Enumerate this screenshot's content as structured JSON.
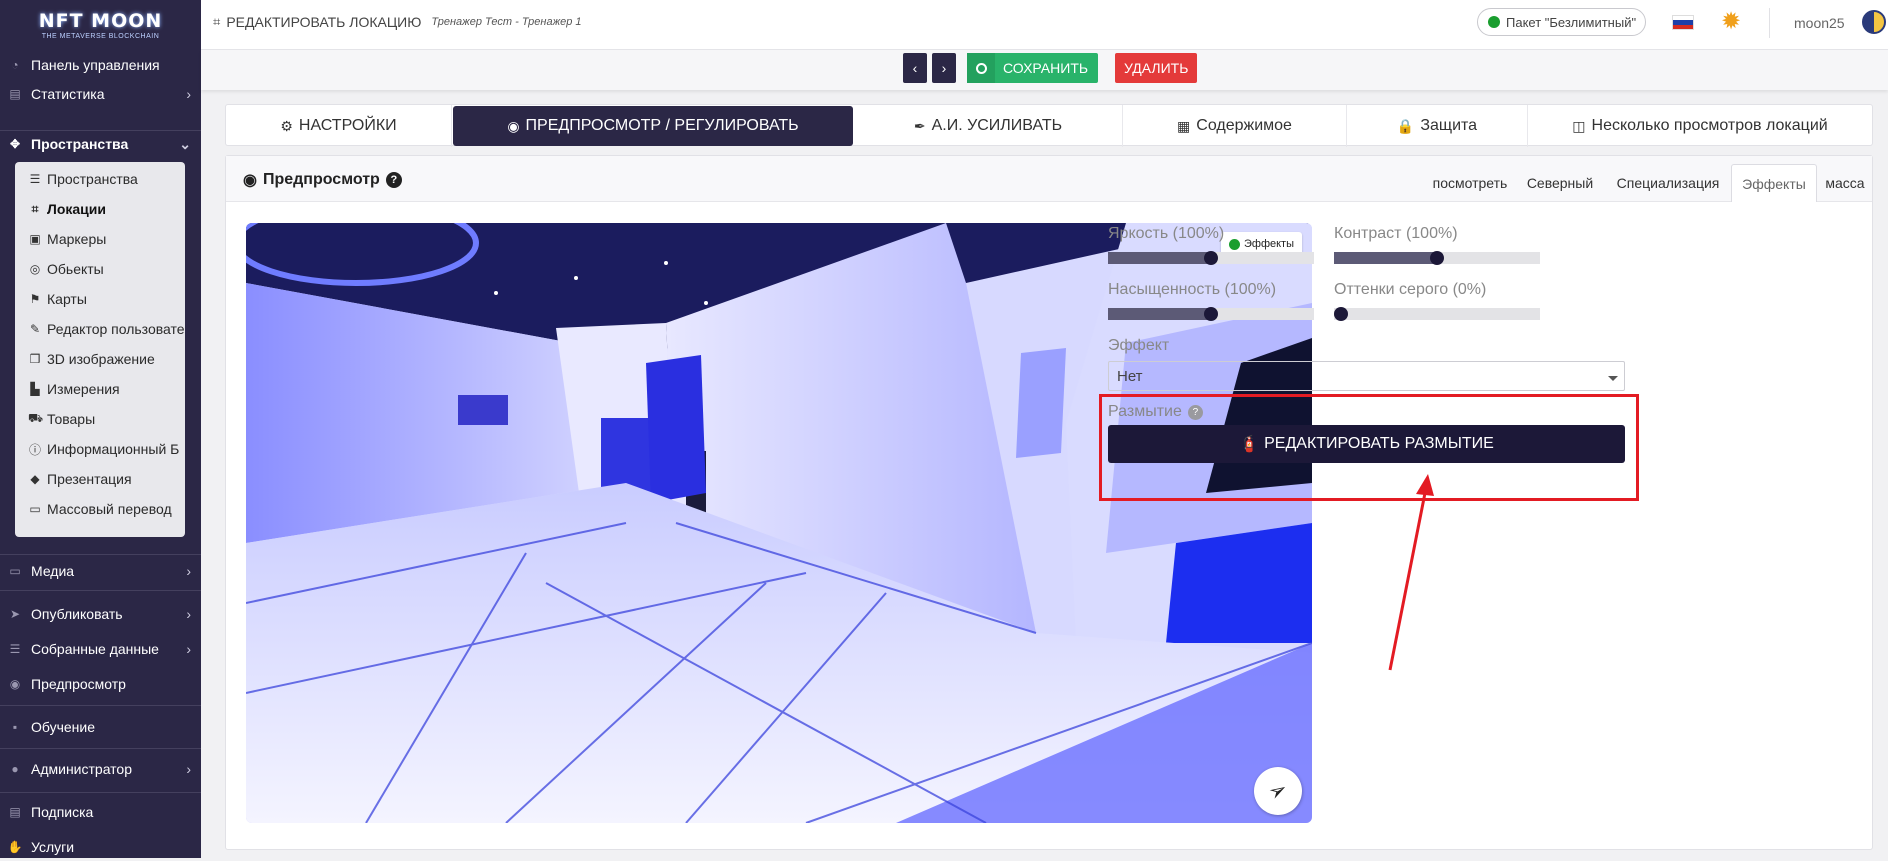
{
  "sidebar": {
    "logo": {
      "main": "NFT MOON",
      "tagline": "THE METAVERSE BLOCKCHAIN"
    },
    "items": [
      {
        "label": "Панель управления",
        "icon": "dashboard-icon"
      },
      {
        "label": "Статистика",
        "icon": "chart-icon"
      },
      {
        "label": "Пространства",
        "icon": "spaces-icon"
      },
      {
        "label": "Медиа",
        "icon": "monitor-icon"
      },
      {
        "label": "Опубликовать",
        "icon": "send-icon"
      },
      {
        "label": "Собранные данные",
        "icon": "database-icon"
      },
      {
        "label": "Предпросмотр",
        "icon": "eye-icon"
      },
      {
        "label": "Обучение",
        "icon": "briefcase-icon"
      },
      {
        "label": "Администратор",
        "icon": "user-icon"
      },
      {
        "label": "Подписка",
        "icon": "list-icon"
      },
      {
        "label": "Услуги",
        "icon": "hand-icon"
      }
    ],
    "subitems": [
      {
        "label": "Пространства",
        "icon": "list-icon"
      },
      {
        "label": "Локации",
        "icon": "location-icon"
      },
      {
        "label": "Маркеры",
        "icon": "image-icon"
      },
      {
        "label": "Обьекты",
        "icon": "target-icon"
      },
      {
        "label": "Карты",
        "icon": "map-icon"
      },
      {
        "label": "Редактор пользовате",
        "icon": "edit-icon"
      },
      {
        "label": "3D изображение",
        "icon": "cube-icon"
      },
      {
        "label": "Измерения",
        "icon": "ruler-icon"
      },
      {
        "label": "Товары",
        "icon": "cart-icon"
      },
      {
        "label": "Информационный Б",
        "icon": "info-icon"
      },
      {
        "label": "Презентация",
        "icon": "diamond-icon"
      },
      {
        "label": "Массовый перевод",
        "icon": "translate-icon"
      }
    ]
  },
  "header": {
    "title": "РЕДАКТИРОВАТЬ ЛОКАЦИЮ",
    "breadcrumb": "Тренажер Тест - Тренажер 1",
    "plan": "Пакет \"Безлимитный\"",
    "username": "moon25"
  },
  "toolbar": {
    "save_label": "СОХРАНИТЬ",
    "delete_label": "УДАЛИТЬ",
    "prev_label": "‹",
    "next_label": "›"
  },
  "tabs": [
    {
      "label": "НАСТРОЙКИ",
      "icon": "gears-icon"
    },
    {
      "label": "ПРЕДПРОСМОТР / РЕГУЛИРОВАТЬ",
      "icon": "eye-icon"
    },
    {
      "label": "А.И. УСИЛИВАТЬ",
      "icon": "brush-icon"
    },
    {
      "label": "Содержимое",
      "icon": "images-icon"
    },
    {
      "label": "Защита",
      "icon": "lock-icon"
    },
    {
      "label": "Несколько просмотров локаций",
      "icon": "columns-icon"
    }
  ],
  "preview": {
    "title": "Предпросмотр",
    "subtabs": [
      "посмотреть",
      "Северный",
      "Специализация",
      "Эффекты",
      "масса"
    ],
    "effects_badge": "Эффекты"
  },
  "controls": {
    "brightness": {
      "label": "Яркость (100%)",
      "value": 0.5
    },
    "contrast": {
      "label": "Контраст (100%)",
      "value": 0.5
    },
    "saturation": {
      "label": "Насыщенность (100%)",
      "value": 0.5
    },
    "grayscale": {
      "label": "Оттенки серого (0%)",
      "value": 0.0
    },
    "effect_label": "Эффект",
    "effect_value": "Нет",
    "blur_label": "Размытие",
    "blur_button": "РЕДАКТИРОВАТЬ РАЗМЫТИЕ"
  },
  "colors": {
    "sidebar": "#2b2746",
    "accent": "#1c1838",
    "save": "#29b36a",
    "delete": "#e43a3a",
    "highlight": "#e31b23"
  }
}
